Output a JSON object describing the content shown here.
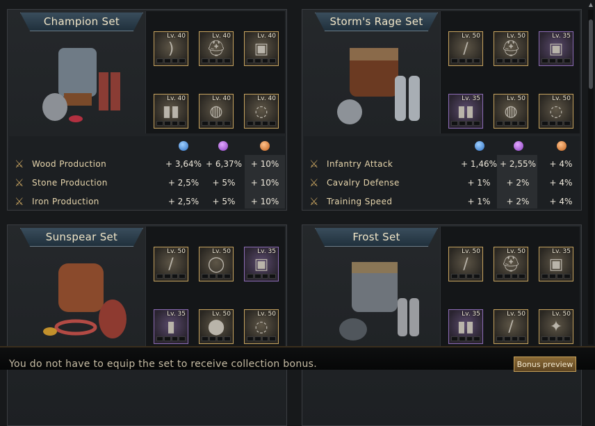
{
  "sets": [
    {
      "title": "Champion Set",
      "slots": [
        {
          "level": "Lv. 40",
          "rarity": "gold",
          "icon": "bow-icon"
        },
        {
          "level": "Lv. 40",
          "rarity": "gold",
          "icon": "helmet-icon"
        },
        {
          "level": "Lv. 40",
          "rarity": "gold",
          "icon": "chainmail-icon"
        },
        {
          "level": "Lv. 40",
          "rarity": "gold",
          "icon": "boots-icon"
        },
        {
          "level": "Lv. 40",
          "rarity": "gold",
          "icon": "ring-icon"
        },
        {
          "level": "Lv. 40",
          "rarity": "gold",
          "icon": "necklace-icon"
        }
      ],
      "stats": [
        {
          "name": "Wood Production",
          "v1": "+ 3,64%",
          "v2": "+ 6,37%",
          "v3": "+ 10%"
        },
        {
          "name": "Stone Production",
          "v1": "+ 2,5%",
          "v2": "+ 5%",
          "v3": "+ 10%"
        },
        {
          "name": "Iron Production",
          "v1": "+ 2,5%",
          "v2": "+ 5%",
          "v3": "+ 10%"
        }
      ],
      "highlight_col": 3
    },
    {
      "title": "Storm's Rage Set",
      "slots": [
        {
          "level": "Lv. 50",
          "rarity": "gold",
          "icon": "sword-icon"
        },
        {
          "level": "Lv. 50",
          "rarity": "gold",
          "icon": "helmet-icon"
        },
        {
          "level": "Lv. 35",
          "rarity": "purple",
          "icon": "armor-icon"
        },
        {
          "level": "Lv. 35",
          "rarity": "purple",
          "icon": "greaves-icon"
        },
        {
          "level": "Lv. 50",
          "rarity": "gold",
          "icon": "ring-icon"
        },
        {
          "level": "Lv. 50",
          "rarity": "gold",
          "icon": "amulet-icon"
        }
      ],
      "stats": [
        {
          "name": "Infantry Attack",
          "v1": "+ 1,46%",
          "v2": "+ 2,55%",
          "v3": "+ 4%"
        },
        {
          "name": "Cavalry Defense",
          "v1": "+ 1%",
          "v2": "+ 2%",
          "v3": "+ 4%"
        },
        {
          "name": "Training Speed",
          "v1": "+ 1%",
          "v2": "+ 2%",
          "v3": "+ 4%"
        }
      ],
      "highlight_col": 2
    },
    {
      "title": "Sunspear Set",
      "slots": [
        {
          "level": "Lv. 50",
          "rarity": "gold",
          "icon": "spear-icon"
        },
        {
          "level": "Lv. 50",
          "rarity": "gold",
          "icon": "bracelet-icon"
        },
        {
          "level": "Lv. 35",
          "rarity": "purple",
          "icon": "armor-icon"
        },
        {
          "level": "Lv. 35",
          "rarity": "purple",
          "icon": "boots-icon"
        },
        {
          "level": "Lv. 50",
          "rarity": "gold",
          "icon": "shield-icon"
        },
        {
          "level": "Lv. 50",
          "rarity": "gold",
          "icon": "amulet-icon"
        }
      ]
    },
    {
      "title": "Frost Set",
      "slots": [
        {
          "level": "Lv. 50",
          "rarity": "gold",
          "icon": "spear-icon"
        },
        {
          "level": "Lv. 50",
          "rarity": "gold",
          "icon": "helmet-icon"
        },
        {
          "level": "Lv. 35",
          "rarity": "gold",
          "icon": "chainmail-icon"
        },
        {
          "level": "Lv. 35",
          "rarity": "purple",
          "icon": "boots-icon"
        },
        {
          "level": "Lv. 50",
          "rarity": "gold",
          "icon": "sword-icon"
        },
        {
          "level": "Lv. 50",
          "rarity": "gold",
          "icon": "shield-icon"
        }
      ]
    }
  ],
  "footer": {
    "note": "You do not have to equip the set to receive collection bonus.",
    "bonus_button": "Bonus preview"
  }
}
